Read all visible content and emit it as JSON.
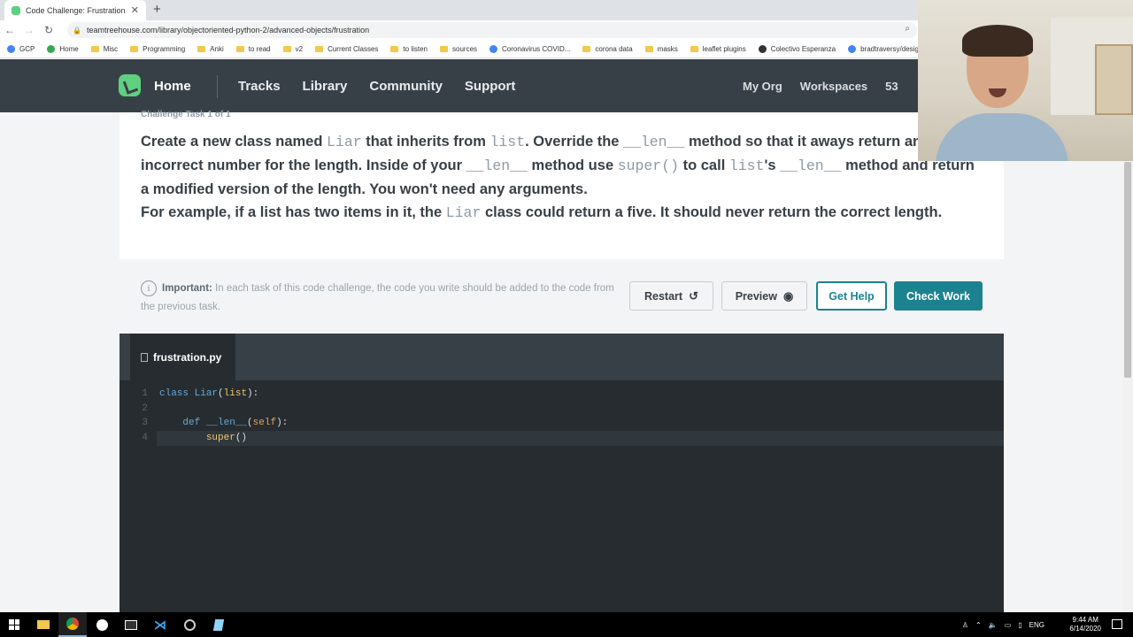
{
  "browser": {
    "tab_title": "Code Challenge: Frustration",
    "url": "teamtreehouse.com/library/objectoriented-python-2/advanced-objects/frustration",
    "bookmarks": [
      {
        "label": "GCP",
        "kind": "app"
      },
      {
        "label": "Home",
        "kind": "app"
      },
      {
        "label": "Misc",
        "kind": "folder"
      },
      {
        "label": "Programming",
        "kind": "folder"
      },
      {
        "label": "Anki",
        "kind": "folder"
      },
      {
        "label": "to read",
        "kind": "folder"
      },
      {
        "label": "v2",
        "kind": "folder"
      },
      {
        "label": "Current Classes",
        "kind": "folder"
      },
      {
        "label": "to listen",
        "kind": "folder"
      },
      {
        "label": "sources",
        "kind": "folder"
      },
      {
        "label": "Coronavirus COVID...",
        "kind": "app"
      },
      {
        "label": "corona data",
        "kind": "folder"
      },
      {
        "label": "masks",
        "kind": "folder"
      },
      {
        "label": "leaflet plugins",
        "kind": "folder"
      },
      {
        "label": "Colectivo Esperanza",
        "kind": "app"
      },
      {
        "label": "bradtraversy/desig...",
        "kind": "app"
      }
    ]
  },
  "header": {
    "home": "Home",
    "nav": [
      "Tracks",
      "Library",
      "Community",
      "Support"
    ],
    "right": [
      "My Org",
      "Workspaces",
      "53"
    ]
  },
  "challenge": {
    "task_label": "Challenge Task 1 of 1",
    "desc": {
      "p1": "Create a new class named ",
      "c1": "Liar",
      "p2": " that inherits from ",
      "c2": "list",
      "p3": ". Override the ",
      "c3": "__len__",
      "p4": " method so that it aways return an incorrect number for the length. Inside of your ",
      "c4": "__len__",
      "p5": " method use ",
      "c5": "super()",
      "p6": " to call ",
      "c6": "list",
      "p7": "'s ",
      "c7": "__len__",
      "p8": " method and return a modified version of the length. You won't need any arguments.",
      "p9": "For example, if a list has two items in it, the ",
      "c8": "Liar",
      "p10": " class could return a five. It should never return the correct length."
    },
    "important_label": "Important:",
    "important_text": " In each task of this code challenge, the code you write should be added to the code from the previous task.",
    "buttons": {
      "restart": "Restart",
      "preview": "Preview",
      "help": "Get Help",
      "check": "Check Work"
    }
  },
  "editor": {
    "filename": "frustration.py",
    "lines": [
      {
        "num": "1",
        "text": "class Liar(list):"
      },
      {
        "num": "2",
        "text": ""
      },
      {
        "num": "3",
        "text": "    def __len__(self):"
      },
      {
        "num": "4",
        "text": "        super()"
      }
    ]
  },
  "taskbar": {
    "lang": "ENG",
    "time": "9:44 AM",
    "date": "6/14/2020"
  },
  "colors": {
    "header_bg": "#384047",
    "accent": "#1d8290",
    "editor_bg": "#262c30",
    "logo": "#5fcf80"
  }
}
